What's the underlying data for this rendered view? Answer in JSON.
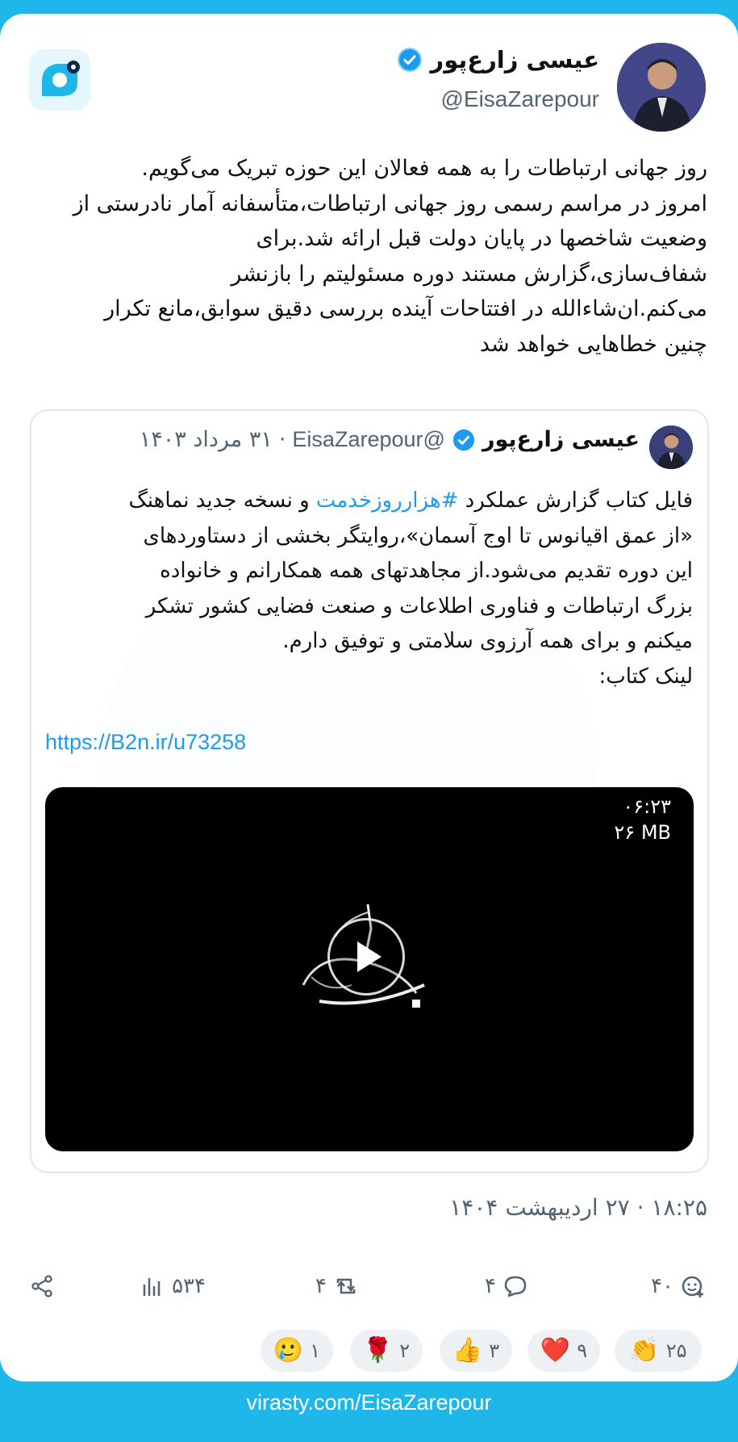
{
  "author": {
    "name": "عیسی زارع‌پور",
    "handle": "@EisaZarepour"
  },
  "post": {
    "lines": [
      "روز جهانی ارتباطات را به همه فعالان این حوزه تبریک می‌گویم.",
      "امروز در مراسم رسمی روز جهانی ارتباطات،متأسفانه آمار نادرستی از",
      "وضعیت شاخصها در پایان دولت قبل ارائه شد.برای",
      "شفاف‌سازی،گزارش مستند دوره مسئولیتم را بازنشر",
      "می‌کنم.ان‌شاءالله در افتتاحات آینده بررسی دقیق سوابق،مانع تکرار",
      "چنین خطاهایی خواهد شد"
    ],
    "timestamp": "۱۸:۲۵ · ۲۷ اردیبهشت ۱۴۰۴"
  },
  "quoted": {
    "name": "عیسی زارع‌پور",
    "handle": "@EisaZarepour",
    "separator": "·",
    "date": "۳۱ مرداد ۱۴۰۳",
    "line1_before": "فایل کتاب گزارش عملکرد ",
    "hashtag": "#هزارروزخدمت",
    "line1_after": " و نسخه جدید نماهنگ",
    "lines": [
      "«از عمق اقیانوس تا اوج آسمان»،روایتگر بخشی از دستاوردهای",
      "این دوره تقدیم می‌شود.از مجاهدتهای همه همکارانم و خانواده",
      "بزرگ ارتباطات و فناوری اطلاعات و صنعت فضایی کشور تشکر",
      "میکنم و برای همه آرزوی سلامتی و توفیق دارم.",
      "لینک کتاب:"
    ],
    "link": "https://B2n.ir/u73258",
    "video": {
      "duration": "۰۶:۲۳",
      "size": "۲۶ MB"
    }
  },
  "stats": {
    "reactions": "۴۰",
    "replies": "۴",
    "reposts": "۴",
    "views": "۵۳۴"
  },
  "emoji_reactions": [
    {
      "emoji": "👏",
      "count": "۲۵"
    },
    {
      "emoji": "❤️",
      "count": "۹"
    },
    {
      "emoji": "👍",
      "count": "۳"
    },
    {
      "emoji": "🌹",
      "count": "۲"
    },
    {
      "emoji": "🥲",
      "count": "۱"
    }
  ],
  "footer": {
    "url": "virasty.com/EisaZarepour"
  },
  "colors": {
    "background": "#1fb6ea",
    "link": "#1d9bf0",
    "muted": "#536471",
    "verified": "#1d9bf0"
  },
  "icons": [
    "verified-badge-icon",
    "virasty-logo",
    "add-reaction-icon",
    "reply-icon",
    "repost-icon",
    "views-icon",
    "share-icon",
    "play-icon"
  ]
}
